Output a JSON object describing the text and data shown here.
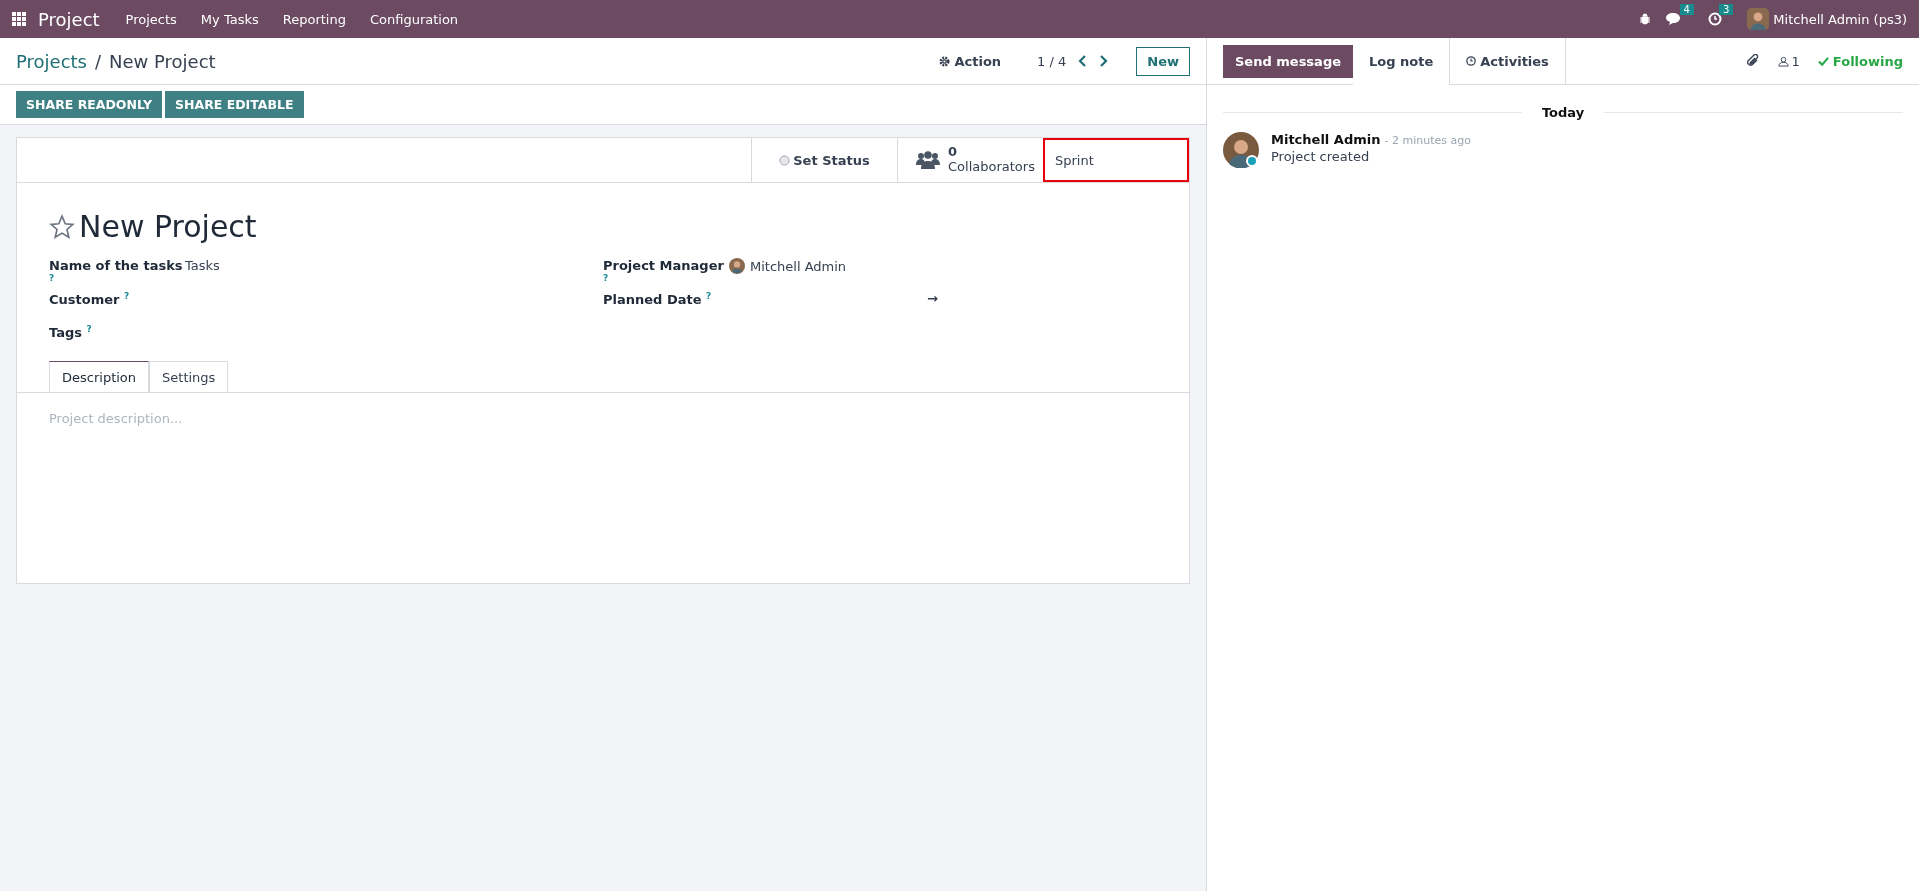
{
  "navbar": {
    "app_name": "Project",
    "menu": [
      "Projects",
      "My Tasks",
      "Reporting",
      "Configuration"
    ],
    "messages_count": "4",
    "activities_count": "3",
    "user": "Mitchell Admin (ps3)"
  },
  "breadcrumb": {
    "parent": "Projects",
    "separator": "/",
    "current": "New Project"
  },
  "control": {
    "action": "Action",
    "pager": "1 / 4",
    "new_button": "New"
  },
  "share_buttons": [
    "SHARE READONLY",
    "SHARE EDITABLE"
  ],
  "button_box": {
    "status": "Set Status",
    "collaborators_count": "0",
    "collaborators_label": "Collaborators",
    "sprint": "Sprint",
    "sprint_highlighted": true
  },
  "form": {
    "title": "New Project",
    "favorite": false,
    "left_fields": [
      {
        "label": "Name of the tasks $^{?}$",
        "value": "Tasks"
      },
      {
        "label": "Customer $^{?}$"
      },
      {
        "label": "Tags $^{?}$"
      }
    ],
    "right_fields": [
      {
        "label": "Project Manager $^{?}$",
        "value": "Mitchell Admin",
        "kind": "user"
      },
      {
        "label": "Planned Date $^{?}$",
        "value": "→",
        "kind": "daterange"
      }
    ],
    "tabs": [
      {
        "label": "Description",
        "selected": true
      },
      {
        "label": "Settings",
        "selected": false
      }
    ],
    "description_placeholder": "Project description..."
  },
  "chatter": {
    "send_message": "Send message",
    "log_note": "Log note",
    "activities": "Activities",
    "followers_count": "1",
    "following": "Following",
    "date_separator": "Today",
    "messages": [
      {
        "author": "Mitchell Admin",
        "time": "- 2 minutes ago",
        "body": "Project created"
      }
    ]
  }
}
